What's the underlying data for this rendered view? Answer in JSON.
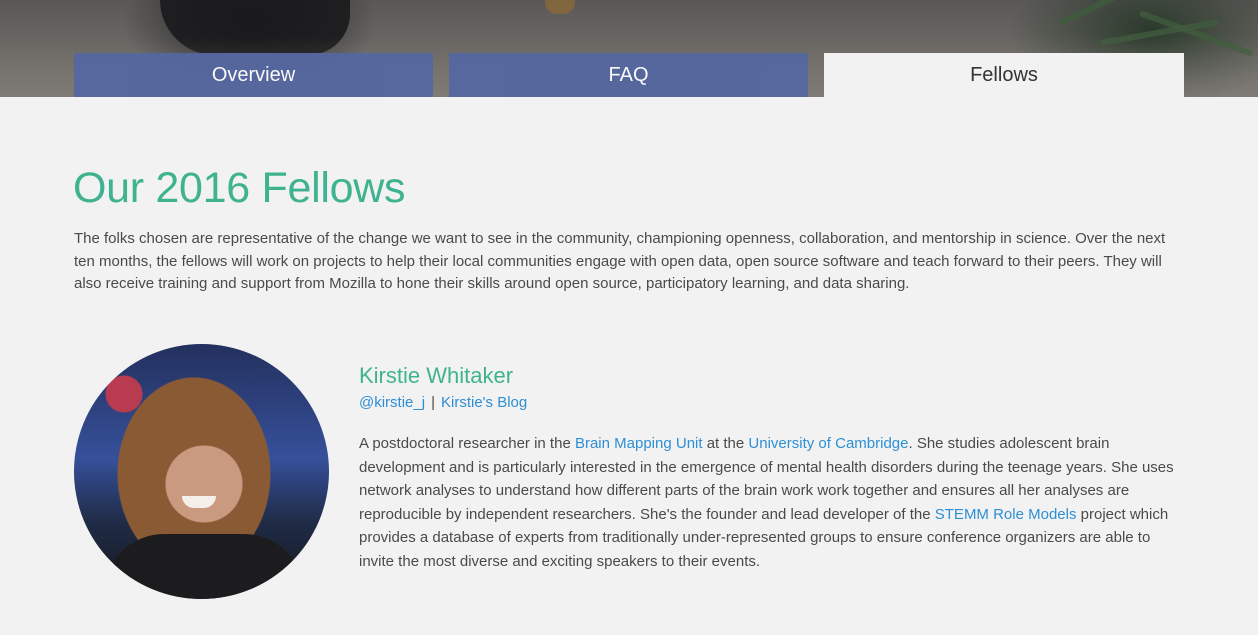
{
  "tabs": [
    {
      "label": "Overview",
      "active": false
    },
    {
      "label": "FAQ",
      "active": false
    },
    {
      "label": "Fellows",
      "active": true
    }
  ],
  "colors": {
    "accent_green": "#3fb38f",
    "tab_blue": "#55679f",
    "link_blue": "#2d8fd5",
    "background": "#f2f2f2"
  },
  "main": {
    "title": "Our 2016 Fellows",
    "intro": "The folks chosen are representative of the change we want to see in the community, championing openness, collaboration, and mentorship in science. Over the next ten months, the fellows will work on projects to help their local communities engage with open data, open source software and teach forward to their peers. They will also receive training and support from Mozilla to hone their skills around open source, participatory learning, and data sharing."
  },
  "fellow": {
    "name": "Kirstie Whitaker",
    "twitter": "@kirstie_j",
    "separator": "|",
    "blog": "Kirstie's Blog",
    "bio": {
      "t1": "A postdoctoral researcher in the ",
      "link1": "Brain Mapping Unit",
      "t2": " at the ",
      "link2": "University of Cambridge",
      "t3": ". She studies adolescent brain development and is particularly interested in the emergence of mental health disorders during the teenage years. She uses network analyses to understand how different parts of the brain work work together and ensures all her analyses are reproducible by independent researchers. She's the founder and lead developer of the ",
      "link3": "STEMM Role Models",
      "t4": " project which provides a database of experts from traditionally under-represented groups to ensure conference organizers are able to invite the most diverse and exciting speakers to their events."
    }
  }
}
